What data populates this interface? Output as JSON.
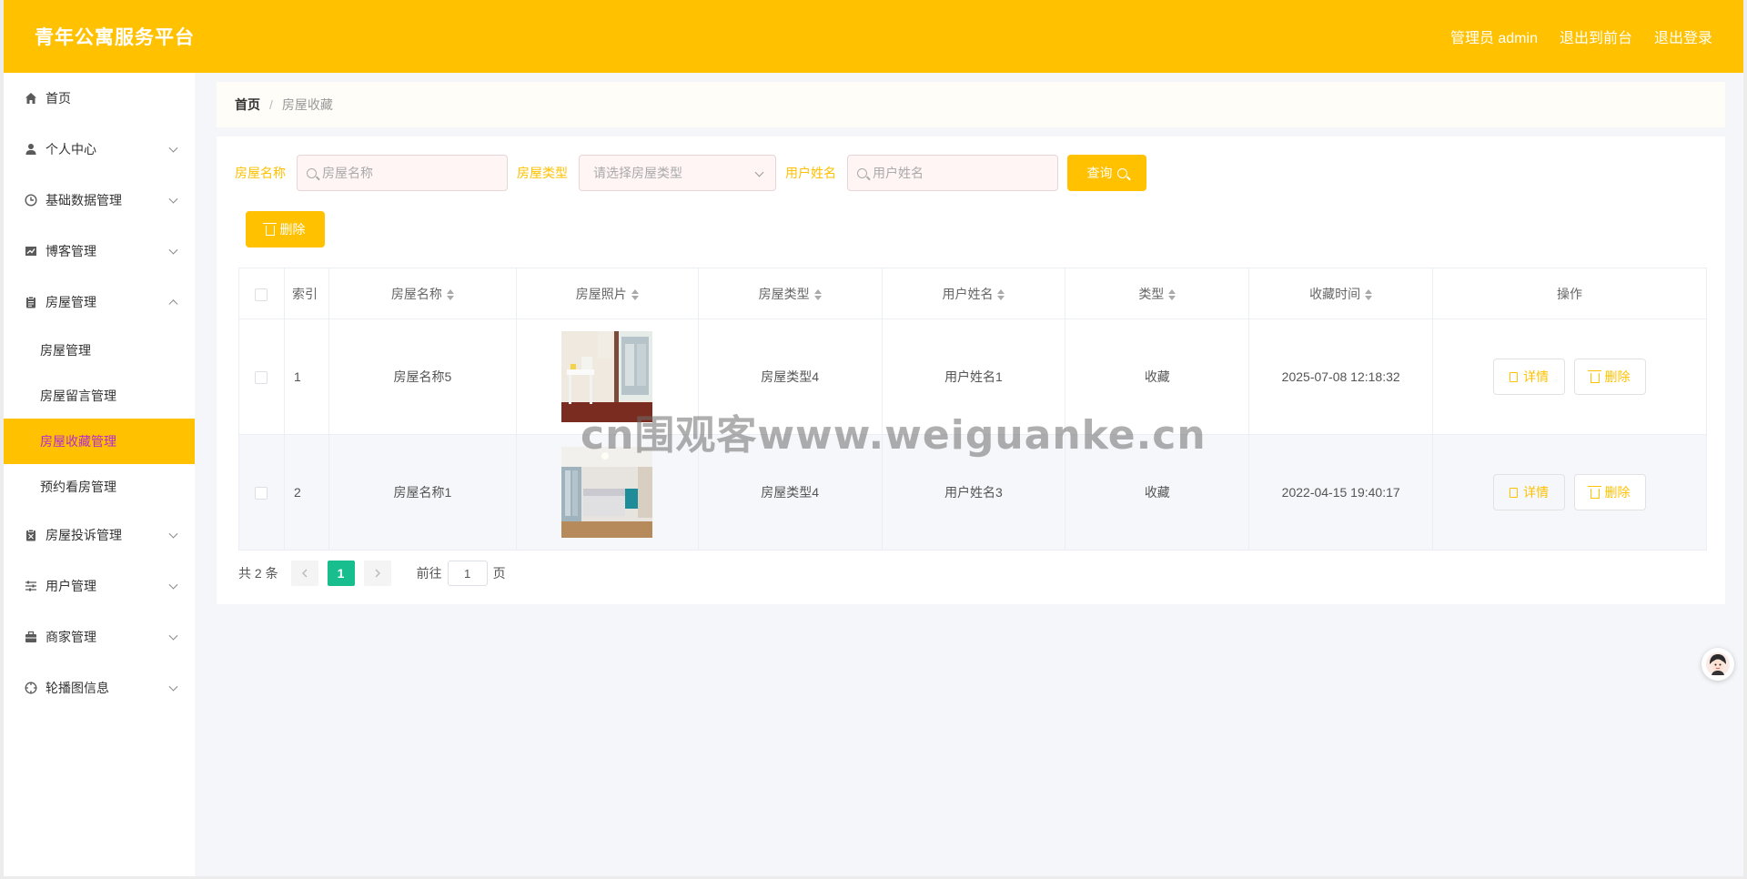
{
  "header": {
    "brand": "青年公寓服务平台",
    "admin": "管理员 admin",
    "to_front": "退出到前台",
    "logout": "退出登录"
  },
  "sidebar": {
    "items": [
      {
        "label": "首页",
        "icon": "home-icon"
      },
      {
        "label": "个人中心",
        "icon": "user-icon"
      },
      {
        "label": "基础数据管理",
        "icon": "clock-icon"
      },
      {
        "label": "博客管理",
        "icon": "chart-icon"
      },
      {
        "label": "房屋管理",
        "icon": "clipboard-icon"
      },
      {
        "label": "房屋投诉管理",
        "icon": "report-icon"
      },
      {
        "label": "用户管理",
        "icon": "sliders-icon"
      },
      {
        "label": "商家管理",
        "icon": "briefcase-icon"
      },
      {
        "label": "轮播图信息",
        "icon": "target-icon"
      }
    ],
    "sub_items": [
      "房屋管理",
      "房屋留言管理",
      "房屋收藏管理",
      "预约看房管理"
    ]
  },
  "breadcrumb": {
    "home": "首页",
    "sep": "/",
    "current": "房屋收藏"
  },
  "search": {
    "house_name_label": "房屋名称",
    "house_name_placeholder": "房屋名称",
    "house_type_label": "房屋类型",
    "house_type_placeholder": "请选择房屋类型",
    "user_name_label": "用户姓名",
    "user_name_placeholder": "用户姓名",
    "query_label": "查询"
  },
  "toolbar": {
    "delete_label": "删除"
  },
  "table": {
    "headers": [
      "索引",
      "房屋名称",
      "房屋照片",
      "房屋类型",
      "用户姓名",
      "类型",
      "收藏时间",
      "操作"
    ],
    "rows": [
      {
        "index": "1",
        "house_name": "房屋名称5",
        "house_type": "房屋类型4",
        "user_name": "用户姓名1",
        "type": "收藏",
        "time": "2025-07-08 12:18:32"
      },
      {
        "index": "2",
        "house_name": "房屋名称1",
        "house_type": "房屋类型4",
        "user_name": "用户姓名3",
        "type": "收藏",
        "time": "2022-04-15 19:40:17"
      }
    ],
    "detail_label": "详情",
    "delete_label": "删除"
  },
  "pager": {
    "total": "共 2 条",
    "current_page": "1",
    "goto_prefix": "前往",
    "goto_value": "1",
    "goto_suffix": "页"
  },
  "watermark": "cn围观客www.weiguanke.cn",
  "colors": {
    "accent": "#ffc100",
    "active_page": "#19be8f",
    "active_submenu_text": "#b52bd3"
  }
}
